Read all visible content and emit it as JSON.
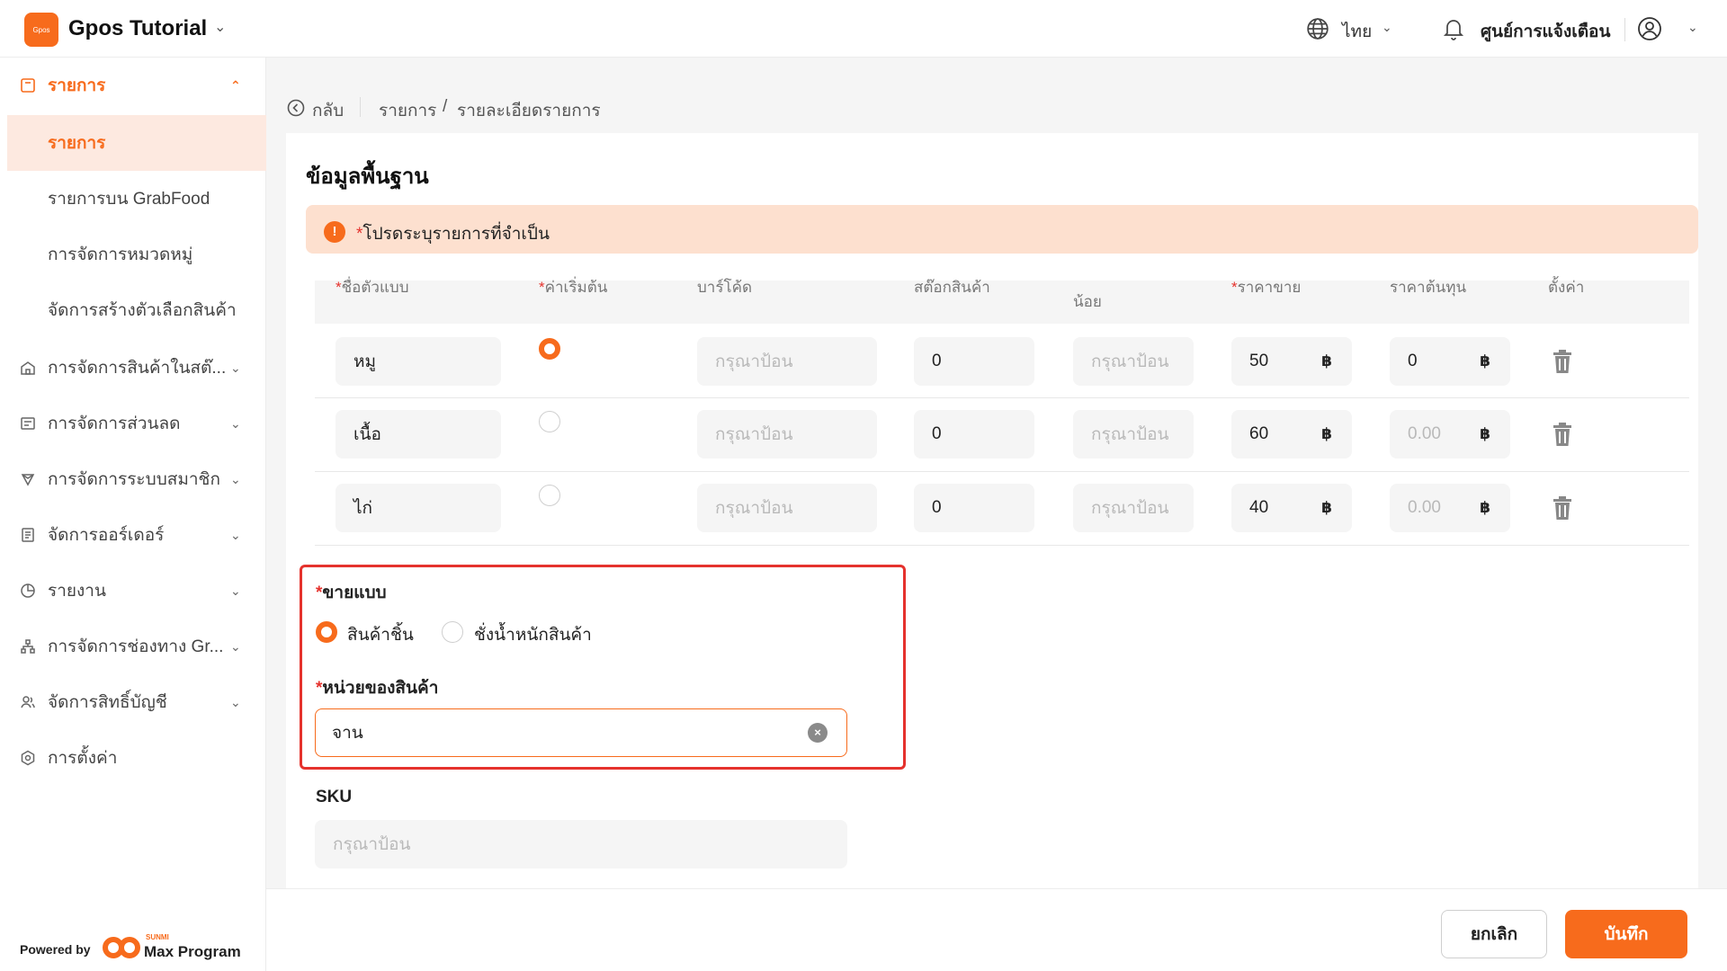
{
  "header": {
    "logo_text": "Gpos",
    "app_title": "Gpos Tutorial",
    "language": "ไทย",
    "notification_center": "ศูนย์การแจ้งเตือน"
  },
  "sidebar": {
    "parent_active": "รายการ",
    "sub_items": [
      {
        "label": "รายการ",
        "active": true
      },
      {
        "label": "รายการบน GrabFood",
        "active": false
      },
      {
        "label": "การจัดการหมวดหมู่",
        "active": false
      },
      {
        "label": "จัดการสร้างตัวเลือกสินค้า",
        "active": false
      }
    ],
    "items": [
      {
        "label": "การจัดการสินค้าในสต๊...",
        "icon": "store-icon"
      },
      {
        "label": "การจัดการส่วนลด",
        "icon": "discount-icon"
      },
      {
        "label": "การจัดการระบบสมาชิก",
        "icon": "member-icon"
      },
      {
        "label": "จัดการออร์เดอร์",
        "icon": "order-icon"
      },
      {
        "label": "รายงาน",
        "icon": "report-icon"
      },
      {
        "label": "การจัดการช่องทาง Gr...",
        "icon": "channel-icon"
      },
      {
        "label": "จัดการสิทธิ์บัญชี",
        "icon": "account-icon"
      },
      {
        "label": "การตั้งค่า",
        "icon": "settings-icon"
      }
    ],
    "powered_by": "Powered by",
    "brand_small": "SUNMI",
    "brand_name": "Max Program"
  },
  "breadcrumb": {
    "back": "กลับ",
    "list": "รายการ",
    "separator": "/",
    "current": "รายละเอียดรายการ"
  },
  "section": {
    "title": "ข้อมูลพื้นฐาน",
    "alert_required_mark": "*",
    "alert_text": "โปรดระบุรายการที่จำเป็น"
  },
  "table": {
    "headers": {
      "variant_name": "ชื่อตัวแบบ",
      "default": "ค่าเริ่มต้น",
      "barcode": "บาร์โค้ด",
      "stock": "สต๊อกสินค้า",
      "low": "น้อย",
      "price": "ราคาขาย",
      "cost": "ราคาต้นทุน",
      "setting": "ตั้งค่า"
    },
    "placeholder": "กรุณาป้อน",
    "currency": "฿",
    "rows": [
      {
        "name": "หมู",
        "default": true,
        "stock": "0",
        "price": "50",
        "cost": "0",
        "cost_is_placeholder": false
      },
      {
        "name": "เนื้อ",
        "default": false,
        "stock": "0",
        "price": "60",
        "cost": "0.00",
        "cost_is_placeholder": true
      },
      {
        "name": "ไก่",
        "default": false,
        "stock": "0",
        "price": "40",
        "cost": "0.00",
        "cost_is_placeholder": true
      }
    ]
  },
  "form": {
    "sell_type_label": "ขายแบบ",
    "sell_type_options": [
      "สินค้าชิ้น",
      "ชั่งน้ำหนักสินค้า"
    ],
    "sell_type_selected": "สินค้าชิ้น",
    "unit_label": "หน่วยของสินค้า",
    "unit_value": "จาน",
    "sku_label": "SKU",
    "sku_placeholder": "กรุณาป้อน"
  },
  "footer": {
    "cancel": "ยกเลิก",
    "save": "บันทึก"
  },
  "colors": {
    "accent": "#f76b1c",
    "alert_bg": "#fde0cf",
    "required": "#e5322d",
    "highlight_border": "#e5322d"
  }
}
